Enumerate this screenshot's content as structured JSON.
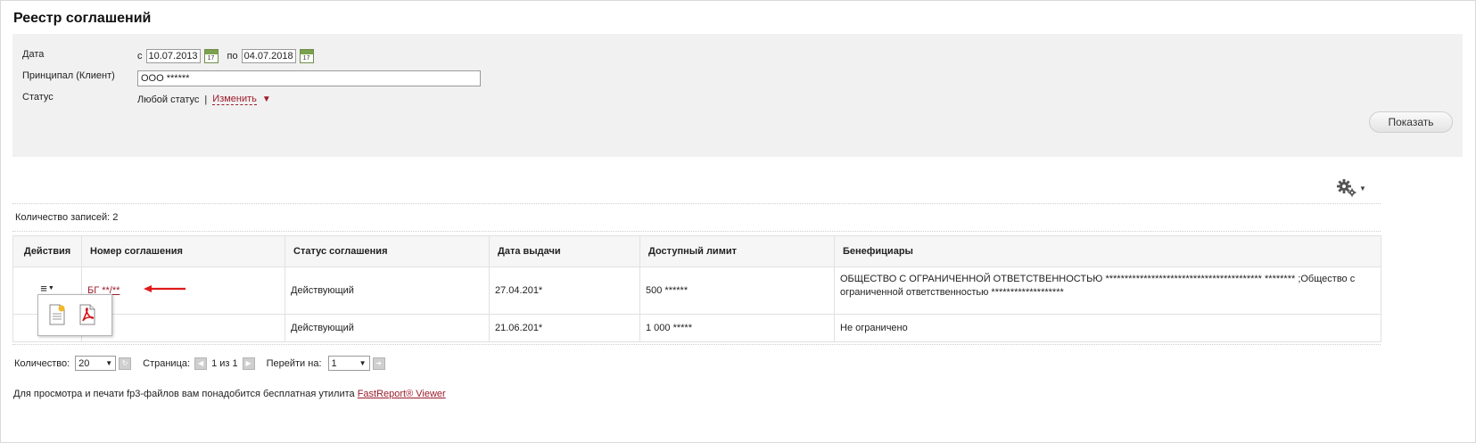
{
  "page": {
    "title": "Реестр соглашений"
  },
  "filters": {
    "date_label": "Дата",
    "date_from_prefix": "с",
    "date_from": "10.07.2013",
    "date_to_prefix": "по",
    "date_to": "04.07.2018",
    "calendar_day": "17",
    "client_label": "Принципал (Клиент)",
    "client_value": "ООО  ******",
    "status_label": "Статус",
    "status_value": "Любой статус",
    "status_separator": "|",
    "status_change": "Изменить",
    "show_button": "Показать"
  },
  "records": {
    "count_text": "Количество записей: 2"
  },
  "table": {
    "columns": [
      "Действия",
      "Номер соглашения",
      "Статус соглашения",
      "Дата выдачи",
      "Доступный лимит",
      "Бенефициары"
    ],
    "rows": [
      {
        "number": "БГ **/**",
        "status": "Действующий",
        "date": "27.04.201*",
        "limit": "500 ******",
        "beneficiary": "ОБЩЕСТВО С ОГРАНИЧЕННОЙ ОТВЕТСТВЕННОСТЬЮ *****************************************  ******** ;Общество с ограниченной ответственностью *******************"
      },
      {
        "number": "",
        "status": "Действующий",
        "date": "21.06.201*",
        "limit": "1 000 *****",
        "beneficiary": "Не ограничено"
      }
    ]
  },
  "pager": {
    "count_label": "Количество:",
    "count_value": "20",
    "page_label": "Страница:",
    "page_info": "1 из 1",
    "goto_label": "Перейти на:",
    "goto_value": "1"
  },
  "footer": {
    "text": "Для просмотра и печати fp3-файлов вам понадобится бесплатная утилита ",
    "link": "FastReport® Viewer"
  },
  "colors": {
    "accent": "#9b1c2c",
    "filter_bg": "#f1f1f1"
  }
}
